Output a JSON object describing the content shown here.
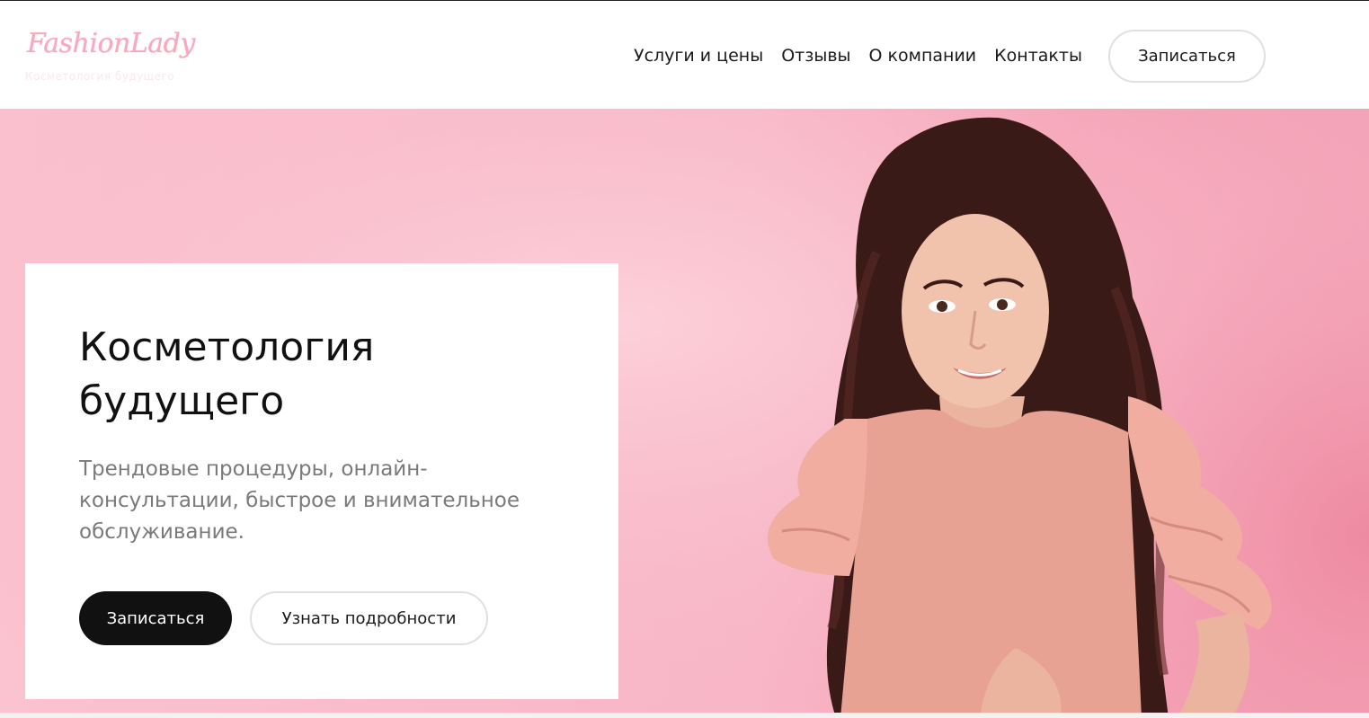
{
  "header": {
    "logo": {
      "name": "FashionLady",
      "tagline": "Косметология будущего"
    },
    "nav": [
      {
        "label": "Услуги и цены"
      },
      {
        "label": "Отзывы"
      },
      {
        "label": "О компании"
      },
      {
        "label": "Контакты"
      }
    ],
    "cta_label": "Записаться"
  },
  "hero": {
    "title": "Косметология будущего",
    "description": "Трендовые процедуры, онлайн-консультации, быстрое и внимательное обслуживание.",
    "primary_button": "Записаться",
    "secondary_button": "Узнать подробности"
  },
  "colors": {
    "brand_pink": "#f7a9c0",
    "hero_bg": "#f8b6c6",
    "primary_button": "#111111"
  }
}
